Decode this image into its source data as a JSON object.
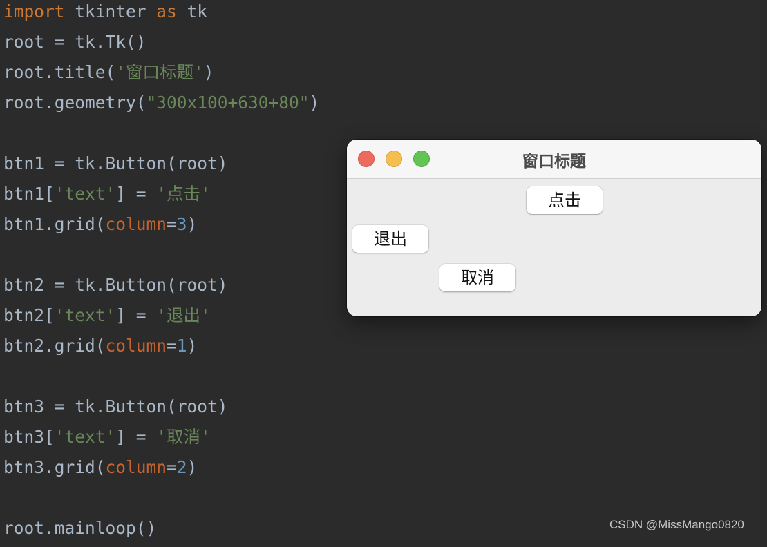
{
  "editor": {
    "lines": [
      {
        "tokens": [
          {
            "t": "import",
            "c": "kw"
          },
          {
            "t": " tkinter ",
            "c": ""
          },
          {
            "t": "as",
            "c": "kw"
          },
          {
            "t": " tk",
            "c": ""
          }
        ]
      },
      {
        "tokens": [
          {
            "t": "root = tk.Tk()",
            "c": ""
          }
        ]
      },
      {
        "tokens": [
          {
            "t": "root.title(",
            "c": ""
          },
          {
            "t": "'窗口标题'",
            "c": "str"
          },
          {
            "t": ")",
            "c": ""
          }
        ]
      },
      {
        "tokens": [
          {
            "t": "root.geometry(",
            "c": ""
          },
          {
            "t": "\"300x100+630+80\"",
            "c": "str"
          },
          {
            "t": ")",
            "c": ""
          }
        ]
      },
      {
        "tokens": []
      },
      {
        "tokens": [
          {
            "t": "btn1 = tk.Button(root)",
            "c": ""
          }
        ]
      },
      {
        "tokens": [
          {
            "t": "btn1[",
            "c": ""
          },
          {
            "t": "'text'",
            "c": "str"
          },
          {
            "t": "] = ",
            "c": ""
          },
          {
            "t": "'点击'",
            "c": "str"
          }
        ]
      },
      {
        "tokens": [
          {
            "t": "btn1.grid(",
            "c": ""
          },
          {
            "t": "column",
            "c": "param"
          },
          {
            "t": "=",
            "c": ""
          },
          {
            "t": "3",
            "c": "num"
          },
          {
            "t": ")",
            "c": ""
          }
        ]
      },
      {
        "tokens": []
      },
      {
        "tokens": [
          {
            "t": "btn2 = tk.Button(root)",
            "c": ""
          }
        ]
      },
      {
        "tokens": [
          {
            "t": "btn2[",
            "c": ""
          },
          {
            "t": "'text'",
            "c": "str"
          },
          {
            "t": "] = ",
            "c": ""
          },
          {
            "t": "'退出'",
            "c": "str"
          }
        ]
      },
      {
        "tokens": [
          {
            "t": "btn2.grid(",
            "c": ""
          },
          {
            "t": "column",
            "c": "param"
          },
          {
            "t": "=",
            "c": ""
          },
          {
            "t": "1",
            "c": "num"
          },
          {
            "t": ")",
            "c": ""
          }
        ]
      },
      {
        "tokens": []
      },
      {
        "tokens": [
          {
            "t": "btn3 = tk.Button(root)",
            "c": ""
          }
        ]
      },
      {
        "tokens": [
          {
            "t": "btn3[",
            "c": ""
          },
          {
            "t": "'text'",
            "c": "str"
          },
          {
            "t": "] = ",
            "c": ""
          },
          {
            "t": "'取消'",
            "c": "str"
          }
        ]
      },
      {
        "tokens": [
          {
            "t": "btn3.grid(",
            "c": ""
          },
          {
            "t": "column",
            "c": "param"
          },
          {
            "t": "=",
            "c": ""
          },
          {
            "t": "2",
            "c": "num"
          },
          {
            "t": ")",
            "c": ""
          }
        ]
      },
      {
        "tokens": []
      },
      {
        "tokens": [
          {
            "t": "root.mainloop()",
            "c": ""
          }
        ]
      }
    ]
  },
  "window": {
    "title": "窗口标题",
    "traffic_lights": [
      "close-icon",
      "minimize-icon",
      "maximize-icon"
    ],
    "buttons": {
      "btn1": "点击",
      "btn2": "退出",
      "btn3": "取消"
    }
  },
  "watermark": "CSDN @MissMango0820"
}
